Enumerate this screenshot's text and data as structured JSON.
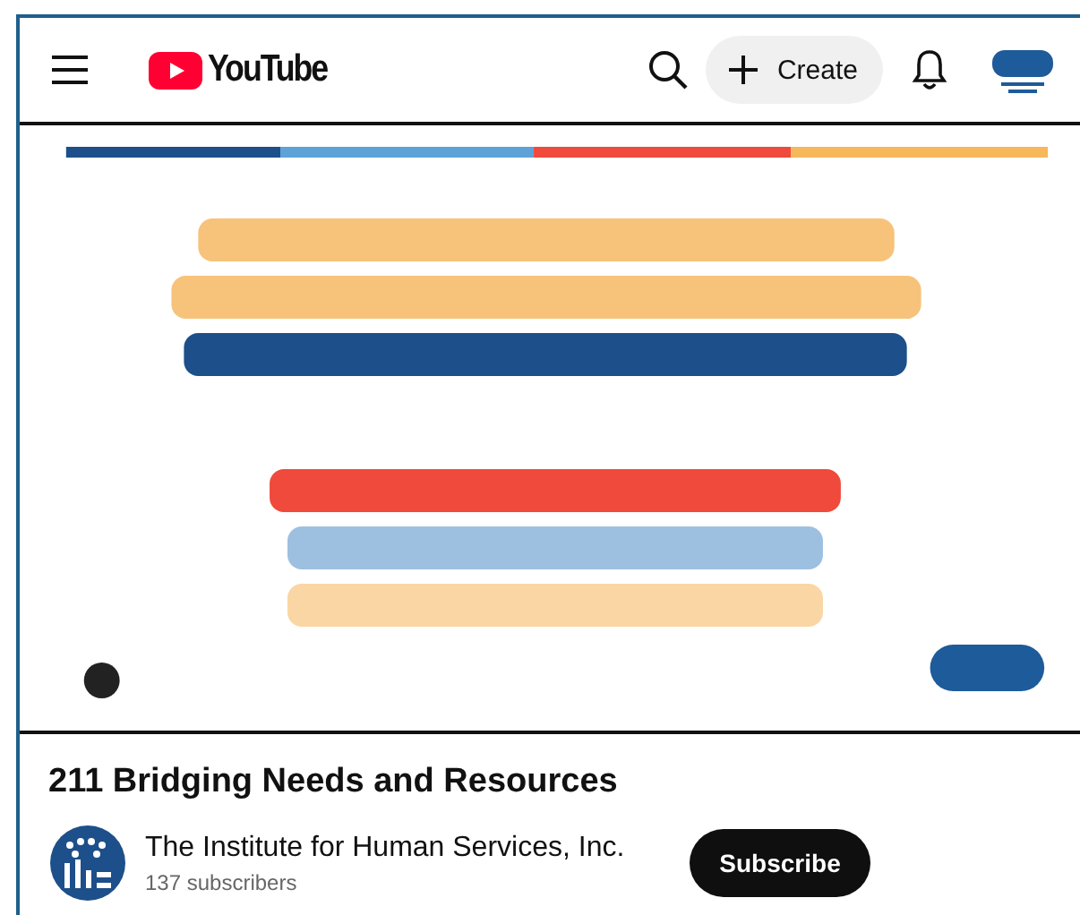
{
  "header": {
    "logo_text": "YouTube",
    "create_label": "Create"
  },
  "title": "211 Bridging Needs and Resources",
  "channel": {
    "name": "The Institute for Human Services, Inc.",
    "subscribers": "137 subscribers",
    "subscribe_label": "Subscribe"
  }
}
